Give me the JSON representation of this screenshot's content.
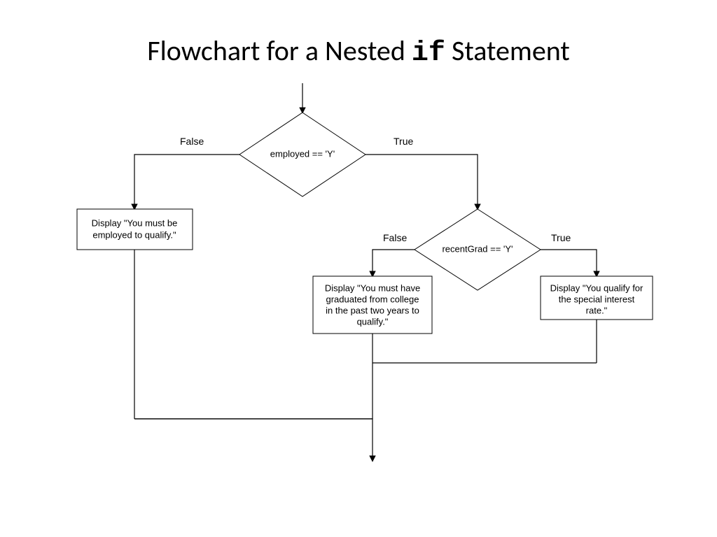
{
  "title_prefix": "Flowchart for a Nested ",
  "title_mono": "if",
  "title_suffix": " Statement",
  "decision1": {
    "condition": "employed == 'Y'",
    "false_label": "False",
    "true_label": "True"
  },
  "decision2": {
    "condition": "recentGrad == 'Y'",
    "false_label": "False",
    "true_label": "True"
  },
  "box_not_employed": "Display \"You must be employed to qualify.\"",
  "box_not_recent_grad": "Display \"You must have graduated from college in the past two years to qualify.\"",
  "box_qualify": "Display \"You qualify for the special interest rate.\""
}
